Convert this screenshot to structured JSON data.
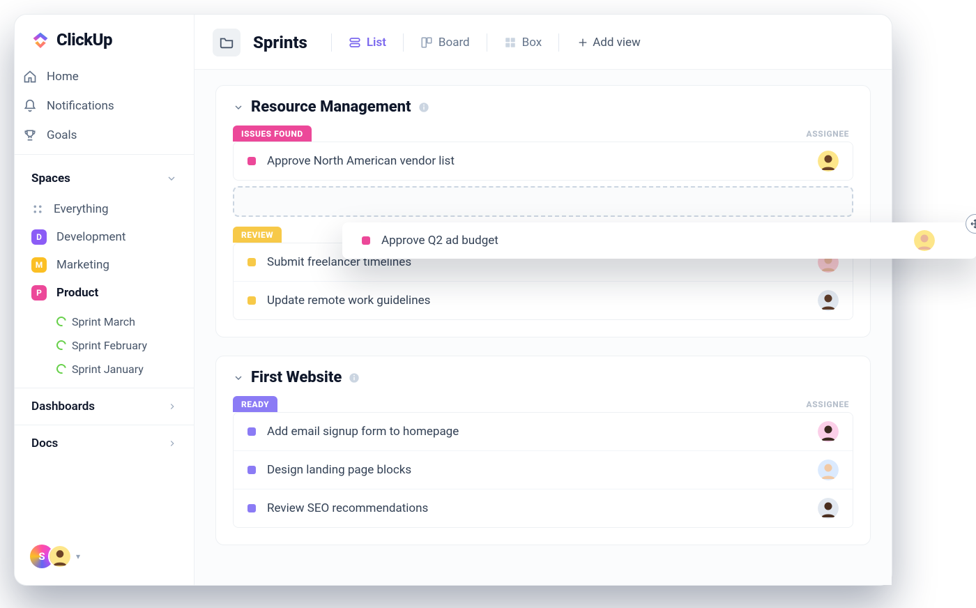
{
  "app": {
    "name": "ClickUp"
  },
  "sidebar": {
    "nav": {
      "home": "Home",
      "notifications": "Notifications",
      "goals": "Goals"
    },
    "spaces_header": "Spaces",
    "everything": "Everything",
    "spaces": [
      {
        "letter": "D",
        "label": "Development"
      },
      {
        "letter": "M",
        "label": "Marketing"
      },
      {
        "letter": "P",
        "label": "Product"
      }
    ],
    "sprints": [
      {
        "label": "Sprint  March"
      },
      {
        "label": "Sprint  February"
      },
      {
        "label": "Sprint January"
      }
    ],
    "dashboards": "Dashboards",
    "docs": "Docs",
    "footer_initial": "S"
  },
  "header": {
    "title": "Sprints",
    "views": {
      "list": "List",
      "board": "Board",
      "box": "Box",
      "add": "Add view"
    }
  },
  "groups": [
    {
      "title": "Resource Management",
      "assignee_header": "ASSIGNEE",
      "sections": [
        {
          "status": "ISSUES FOUND",
          "status_color": "#ec4899",
          "dot_color": "#ec4899",
          "tasks": [
            {
              "name": "Approve North American vendor list",
              "avatar_bg": "#fde68a",
              "avatar_skin": "#6b4226"
            }
          ],
          "has_dropzone": true
        },
        {
          "status": "REVIEW",
          "status_color": "#f7c948",
          "dot_color": "#f7c948",
          "tasks": [
            {
              "name": "Submit freelancer timelines",
              "avatar_bg": "#fecdd3",
              "avatar_skin": "#e9b59a"
            },
            {
              "name": "Update remote work guidelines",
              "avatar_bg": "#e2e8f0",
              "avatar_skin": "#5b3a29"
            }
          ]
        }
      ]
    },
    {
      "title": "First Website",
      "assignee_header": "ASSIGNEE",
      "sections": [
        {
          "status": "READY",
          "status_color": "#8b7bf5",
          "dot_color": "#8b7bf5",
          "tasks": [
            {
              "name": "Add email signup form to homepage",
              "avatar_bg": "#fbcfe8",
              "avatar_skin": "#3b2a20"
            },
            {
              "name": "Design landing page blocks",
              "avatar_bg": "#dbeafe",
              "avatar_skin": "#f1c9a5"
            },
            {
              "name": "Review SEO recommendations",
              "avatar_bg": "#e2e8f0",
              "avatar_skin": "#4a2e1f"
            }
          ]
        }
      ]
    }
  ],
  "floating_task": {
    "dot_color": "#ec4899",
    "name": "Approve Q2 ad budget",
    "avatar_bg": "#fde68a",
    "avatar_skin": "#e9b59a"
  }
}
